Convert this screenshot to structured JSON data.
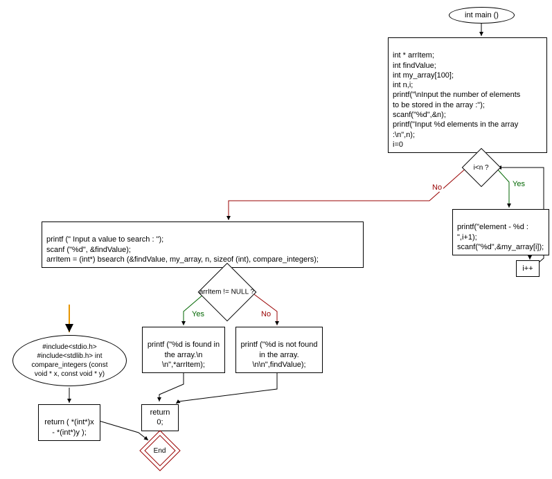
{
  "nodes": {
    "start": "int main ()",
    "init": "int * arrItem;\nint findValue;\nint my_array[100];\nint n,i;\nprintf(\"\\nInput the number of elements\nto be stored in the array :\");\nscanf(\"%d\",&n);\nprintf(\"Input %d elements in the array :\\n\",n);\ni=0",
    "cond_loop": "i<n ?",
    "loop_yes": "Yes",
    "loop_no": "No",
    "loop_body": "printf(\"element - %d : \",i+1);\nscanf(\"%d\",&my_array[i]);",
    "incr": "i++",
    "search": "printf (\" Input a value to search : \");\nscanf (\"%d\", &findValue);\narrItem = (int*) bsearch (&findValue, my_array, n, sizeof (int), compare_integers);",
    "cond_null": "arrItem != NULL ?",
    "null_yes": "Yes",
    "null_no": "No",
    "found": "printf (\"%d is found in\nthe array.\\n\n\\n\",*arrItem);",
    "notfound": "printf (\"%d is not found\nin the array.\n\\n\\n\",findValue);",
    "ret0": "return 0;",
    "include": "#include<stdio.h>\n#include<stdlib.h> int\ncompare_integers (const\nvoid * x, const void * y)",
    "cmpret": "return ( *(int*)x\n- *(int*)y );",
    "end": "End"
  }
}
